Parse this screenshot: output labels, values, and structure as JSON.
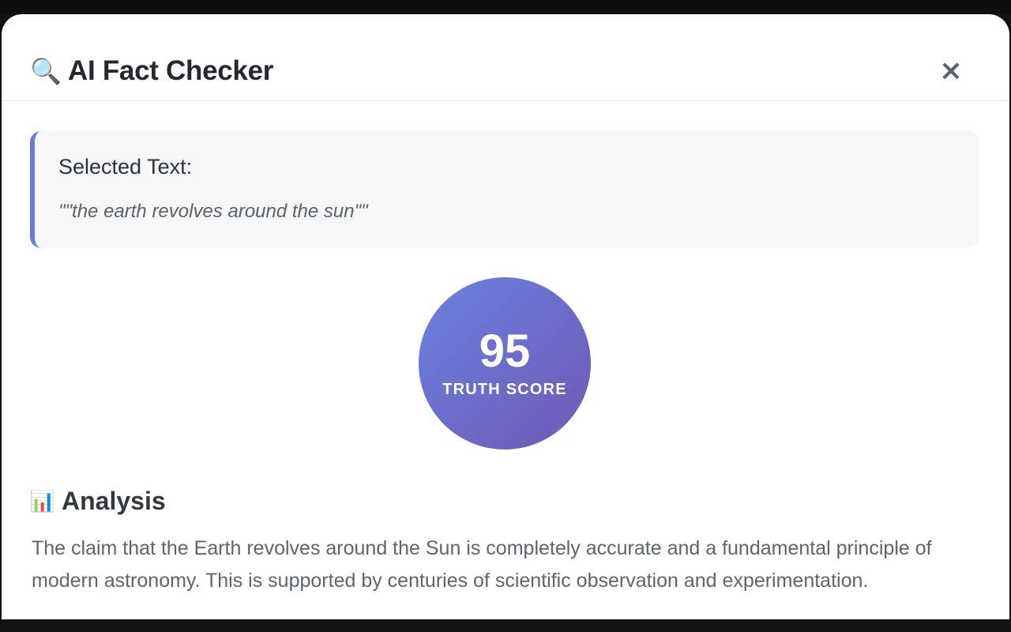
{
  "header": {
    "icon": "magnifier-icon",
    "icon_glyph": "🔍",
    "title": "AI Fact Checker",
    "close_glyph": "×"
  },
  "selected": {
    "label": "Selected Text:",
    "quote": "\"\"the earth revolves around the sun\"\""
  },
  "score": {
    "value": "95",
    "label": "TRUTH SCORE",
    "value_numeric": 95
  },
  "analysis": {
    "icon": "bar-chart-icon",
    "icon_glyph": "📊",
    "title": "Analysis",
    "text": "The claim that the Earth revolves around the Sun is completely accurate and a fundamental principle of modern astronomy. This is supported by centuries of scientific observation and experimentation."
  },
  "colors": {
    "accent_border": "#6b7ad9",
    "gradient_start": "#6a82e0",
    "gradient_end": "#6f59b4",
    "panel_bg": "#f6f7f9"
  }
}
